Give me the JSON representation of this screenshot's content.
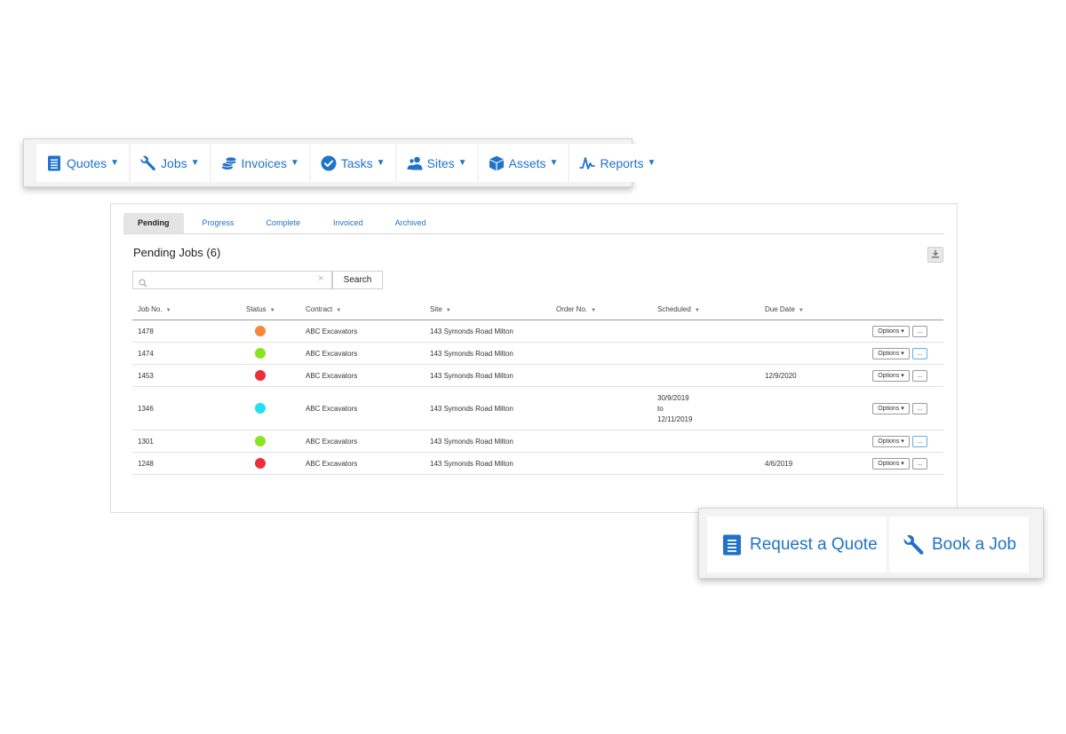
{
  "colors": {
    "accent": "#1f73c9",
    "status_orange": "#f5883a",
    "status_green": "#88e421",
    "status_red": "#ee2e3c",
    "status_cyan": "#22e0f2"
  },
  "nav": {
    "items": [
      {
        "label": "Quotes",
        "icon": "document-icon"
      },
      {
        "label": "Jobs",
        "icon": "wrench-icon"
      },
      {
        "label": "Invoices",
        "icon": "coins-icon"
      },
      {
        "label": "Tasks",
        "icon": "check-circle-icon"
      },
      {
        "label": "Sites",
        "icon": "users-icon"
      },
      {
        "label": "Assets",
        "icon": "box-icon"
      },
      {
        "label": "Reports",
        "icon": "pulse-icon"
      }
    ],
    "caret": "▼"
  },
  "tabs": {
    "pending": "Pending",
    "progress": "Progress",
    "complete": "Complete",
    "invoiced": "Invoiced",
    "archived": "Archived"
  },
  "panel": {
    "title": "Pending Jobs (6)"
  },
  "search": {
    "value": "",
    "placeholder": "",
    "clear": "×",
    "button": "Search"
  },
  "table": {
    "headers": {
      "job_no": "Job No.",
      "status": "Status",
      "contract": "Contract",
      "site": "Site",
      "order_no": "Order No.",
      "scheduled": "Scheduled",
      "due_date": "Due Date"
    },
    "sort_glyph": "▼",
    "options_label": "Options ▾",
    "more_label": "...",
    "rows": [
      {
        "job_no": "1478",
        "status": "orange",
        "contract": "ABC Excavators",
        "site": "143 Symonds Road Milton",
        "order_no": "",
        "scheduled": "",
        "due_date": ""
      },
      {
        "job_no": "1474",
        "status": "green",
        "contract": "ABC Excavators",
        "site": "143 Symonds Road Milton",
        "order_no": "",
        "scheduled": "",
        "due_date": ""
      },
      {
        "job_no": "1453",
        "status": "red",
        "contract": "ABC Excavators",
        "site": "143 Symonds Road Milton",
        "order_no": "",
        "scheduled": "",
        "due_date": "12/9/2020"
      },
      {
        "job_no": "1346",
        "status": "cyan",
        "contract": "ABC Excavators",
        "site": "143 Symonds Road Milton",
        "order_no": "",
        "scheduled_from": "30/9/2019",
        "scheduled_to_word": "to",
        "scheduled_to": "12/11/2019",
        "due_date": ""
      },
      {
        "job_no": "1301",
        "status": "green",
        "contract": "ABC Excavators",
        "site": "143 Symonds Road Milton",
        "order_no": "",
        "scheduled": "",
        "due_date": ""
      },
      {
        "job_no": "1248",
        "status": "red",
        "contract": "ABC Excavators",
        "site": "143 Symonds Road Milton",
        "order_no": "",
        "scheduled": "",
        "due_date": "4/6/2019"
      }
    ]
  },
  "actions": {
    "request_quote": "Request a Quote",
    "book_job": "Book a Job"
  }
}
